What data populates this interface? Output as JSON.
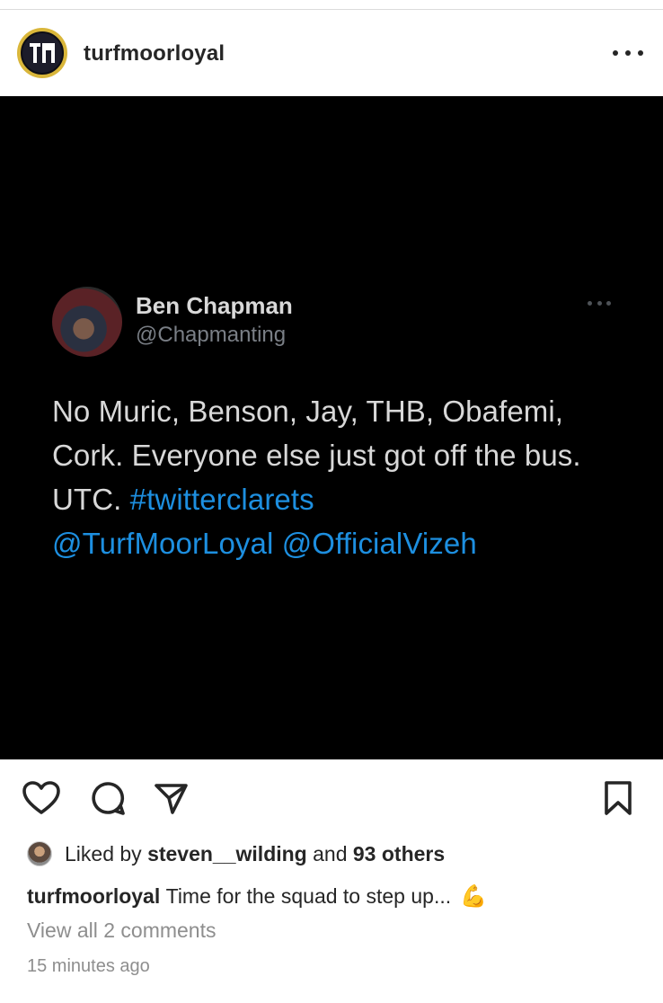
{
  "post": {
    "username": "turfmoorloyal",
    "avatar_monogram": "TM",
    "more_icon": "more-horizontal-icon"
  },
  "tweet": {
    "name": "Ben Chapman",
    "handle": "@Chapmanting",
    "text_plain": "No Muric, Benson, Jay, THB, Obafemi, Cork. Everyone else just got off the bus. UTC. ",
    "hashtag": "#twitterclarets",
    "mention_1": "@TurfMoorLoyal",
    "mention_2": "@OfficialVizeh",
    "link_color": "#1d8fe0",
    "background": "#000000"
  },
  "actions": {
    "like_icon": "heart-icon",
    "comment_icon": "comment-icon",
    "share_icon": "send-icon",
    "save_icon": "bookmark-icon"
  },
  "likes": {
    "prefix": "Liked by",
    "user": "steven__wilding",
    "connector": "and",
    "others": "93 others"
  },
  "caption": {
    "username": "turfmoorloyal",
    "text": "Time for the squad to step up...",
    "emoji": "💪"
  },
  "comments_link": "View all 2 comments",
  "timestamp": "15 minutes ago"
}
